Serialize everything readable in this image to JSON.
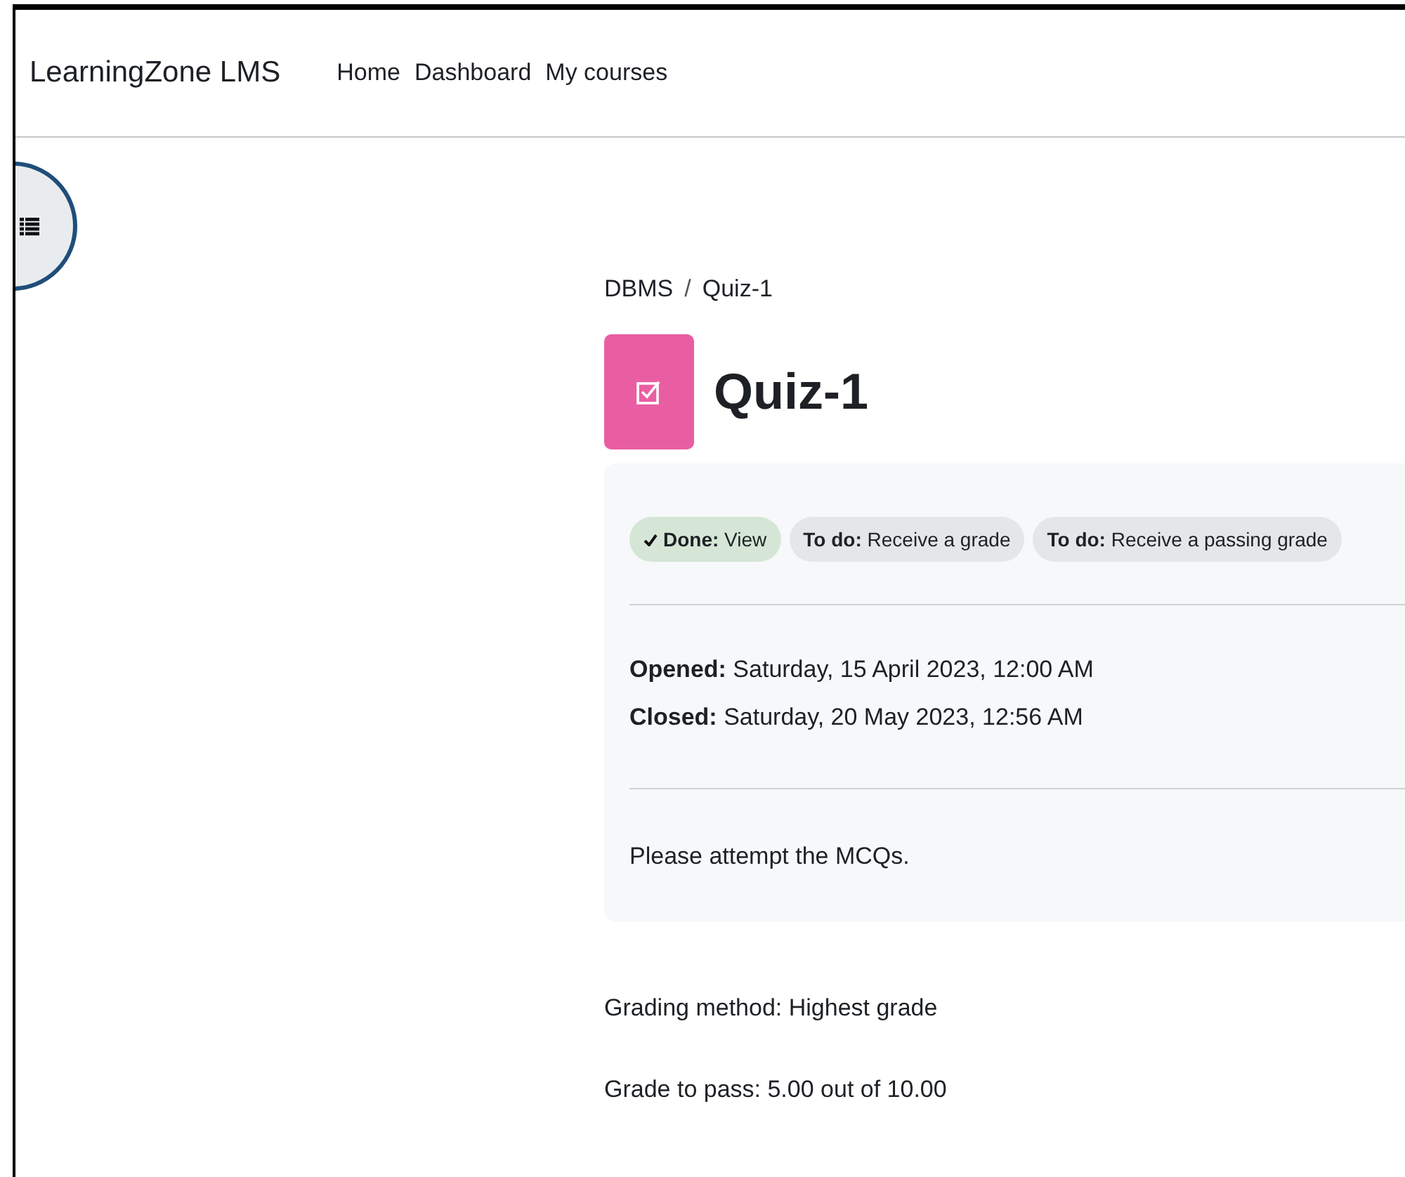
{
  "site": {
    "brand": "LearningZone LMS",
    "nav": [
      "Home",
      "Dashboard",
      "My courses"
    ]
  },
  "breadcrumb": [
    "DBMS",
    "Quiz-1"
  ],
  "breadcrumb_separator": "/",
  "title": "Quiz-1",
  "completions": [
    {
      "text": "**Done:** View",
      "done": true
    },
    {
      "text": "**To do:** Receive a grade",
      "done": false
    },
    {
      "text": "**To do:** Receive a passing grade",
      "done": false
    }
  ],
  "dates": [
    "**Opened:** Saturday, 15 April 2023, 12:00 AM",
    "**Closed:** Saturday, 20 May 2023, 12:56 AM"
  ],
  "description": "Please attempt the MCQs.",
  "info": [
    "Grading method: Highest grade",
    "Grade to pass: 5.00 out of 10.00"
  ]
}
